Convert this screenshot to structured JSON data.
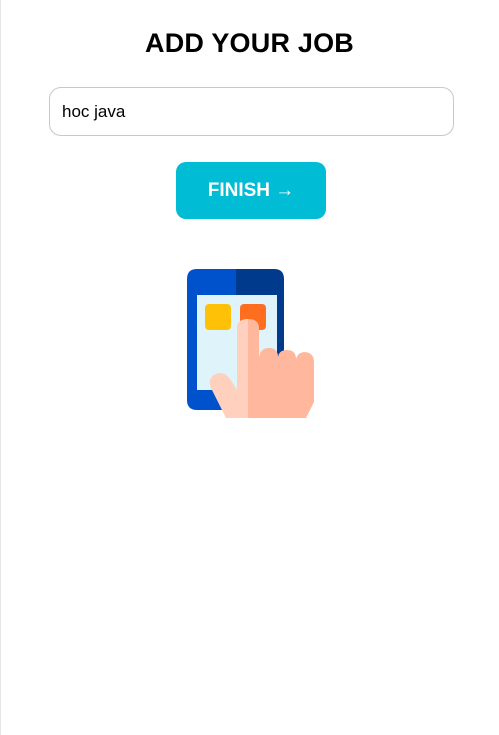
{
  "page": {
    "title": "ADD YOUR JOB"
  },
  "job_input": {
    "value": "hoc java"
  },
  "finish_button": {
    "label": "FINISH →"
  },
  "illustration": {
    "icon": "phone-tap-icon"
  },
  "colors": {
    "accent": "#00bcd4",
    "phone_dark": "#003a8c",
    "phone_blue": "#0052cc",
    "screen": "#dff3fb",
    "tile_yellow": "#ffc107",
    "tile_orange": "#ff6d1f",
    "hand_light": "#ffd0bd",
    "hand_dark": "#ffb89d"
  }
}
